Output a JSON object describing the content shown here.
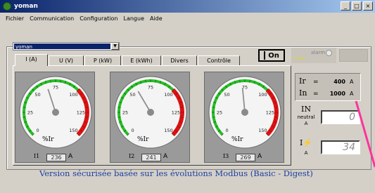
{
  "window": {
    "title": "yoman",
    "buttons": [
      "_",
      "□",
      "×"
    ]
  },
  "menu": [
    "Fichier",
    "Communication",
    "Configuration",
    "Langue",
    "Aide"
  ],
  "device_selector": {
    "value": "yoman",
    "dropdown_icon": "▼"
  },
  "tabs": [
    {
      "label": "I (A)",
      "active": true
    },
    {
      "label": "U (V)",
      "active": false
    },
    {
      "label": "P (kW)",
      "active": false
    },
    {
      "label": "E (kWh)",
      "active": false
    },
    {
      "label": "Divers",
      "active": false
    },
    {
      "label": "Contrôle",
      "active": false
    }
  ],
  "on_button": {
    "label": "On"
  },
  "alarm": {
    "label": "alarm",
    "sub_label": "V max",
    "led_state": "off"
  },
  "gauges": [
    {
      "name": "I1",
      "value": "236",
      "unit": "A",
      "unit_label": "%Ir",
      "needle_percent": 65
    },
    {
      "name": "I2",
      "value": "241",
      "unit": "A",
      "unit_label": "%Ir",
      "needle_percent": 58
    },
    {
      "name": "I3",
      "value": "269",
      "unit": "A",
      "unit_label": "%Ir",
      "needle_percent": 72
    }
  ],
  "gauge_scale": {
    "ticks": [
      "0",
      "25",
      "50",
      "75",
      "100",
      "125",
      "150"
    ]
  },
  "ratings": [
    {
      "name": "Ir",
      "eq": "=",
      "value": "400",
      "unit": "A"
    },
    {
      "name": "In",
      "eq": "=",
      "value": "1000",
      "unit": "A"
    }
  ],
  "neutral": {
    "name": "IN",
    "sub1": "neutral",
    "sub2": "A",
    "value": "0"
  },
  "earth": {
    "name": "I⚡",
    "sub": "A",
    "value": "34"
  },
  "footer": "Version sécurisée basée sur les évolutions Modbus (Basic - Digest)",
  "colors": {
    "green_arc": "#22c022",
    "red_arc": "#e01010",
    "footer_text": "#1a3ea0",
    "pointer_line": "#ff3399"
  }
}
